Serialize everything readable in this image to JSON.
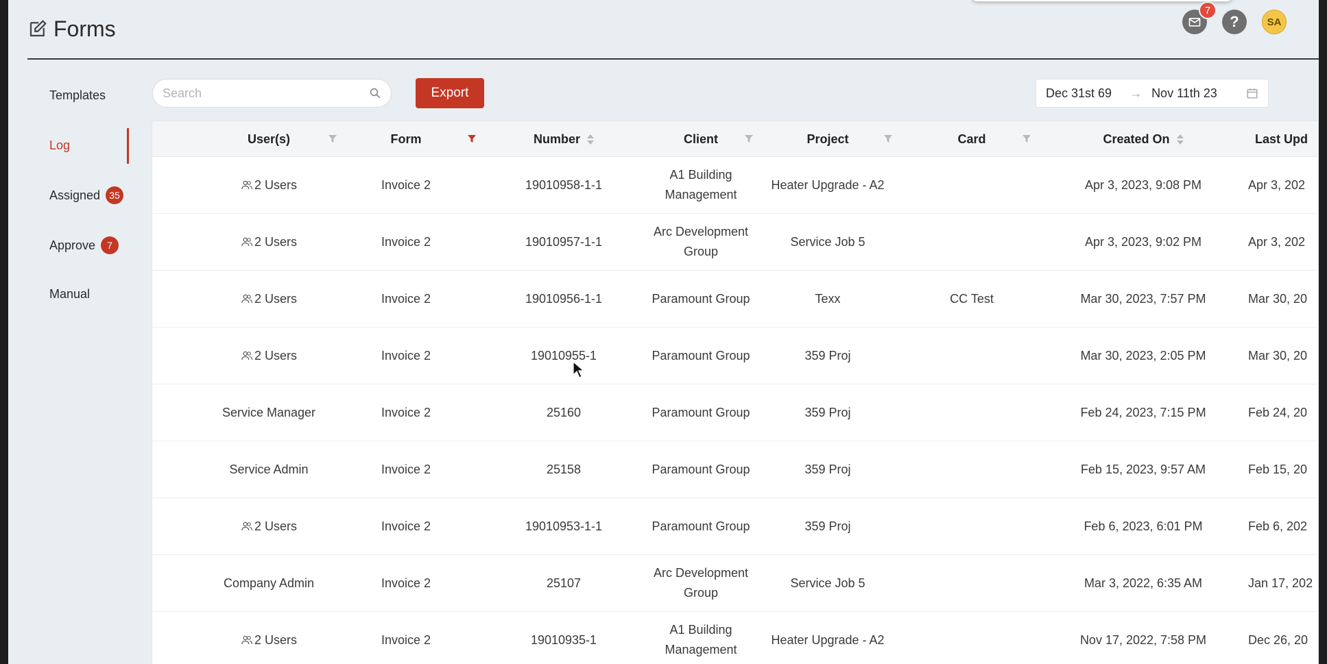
{
  "header": {
    "title": "Forms",
    "icon": "edit-icon"
  },
  "top_actions": {
    "mail_badge": "7",
    "help": "?",
    "avatar": "SA"
  },
  "sidebar": {
    "items": [
      {
        "label": "Templates",
        "badge": null
      },
      {
        "label": "Log",
        "badge": null,
        "active": true
      },
      {
        "label": "Assigned",
        "badge": "35"
      },
      {
        "label": "Approve",
        "badge": "7"
      },
      {
        "label": "Manual",
        "badge": null
      }
    ]
  },
  "toolbar": {
    "search_placeholder": "Search",
    "export_label": "Export",
    "date_from": "Dec 31st 69",
    "date_to": "Nov 11th 23",
    "arrow": "→"
  },
  "table": {
    "columns": [
      "User(s)",
      "Form",
      "Number",
      "Client",
      "Project",
      "Card",
      "Created On",
      "Last Upd"
    ],
    "rows": [
      {
        "users": "2 Users",
        "multi": true,
        "form": "Invoice 2",
        "number": "19010958-1-1",
        "client": "A1 Building Management",
        "project": "Heater Upgrade - A2",
        "card": "",
        "created": "Apr 3, 2023, 9:08 PM",
        "updated": "Apr 3, 202"
      },
      {
        "users": "2 Users",
        "multi": true,
        "form": "Invoice 2",
        "number": "19010957-1-1",
        "client": "Arc Development Group",
        "project": "Service Job 5",
        "card": "",
        "created": "Apr 3, 2023, 9:02 PM",
        "updated": "Apr 3, 202"
      },
      {
        "users": "2 Users",
        "multi": true,
        "form": "Invoice 2",
        "number": "19010956-1-1",
        "client": "Paramount Group",
        "project": "Texx",
        "card": "CC Test",
        "created": "Mar 30, 2023, 7:57 PM",
        "updated": "Mar 30, 20"
      },
      {
        "users": "2 Users",
        "multi": true,
        "form": "Invoice 2",
        "number": "19010955-1",
        "client": "Paramount Group",
        "project": "359 Proj",
        "card": "",
        "created": "Mar 30, 2023, 2:05 PM",
        "updated": "Mar 30, 20"
      },
      {
        "users": "Service Manager",
        "multi": false,
        "form": "Invoice 2",
        "number": "25160",
        "client": "Paramount Group",
        "project": "359 Proj",
        "card": "",
        "created": "Feb 24, 2023, 7:15 PM",
        "updated": "Feb 24, 20"
      },
      {
        "users": "Service Admin",
        "multi": false,
        "form": "Invoice 2",
        "number": "25158",
        "client": "Paramount Group",
        "project": "359 Proj",
        "card": "",
        "created": "Feb 15, 2023, 9:57 AM",
        "updated": "Feb 15, 20"
      },
      {
        "users": "2 Users",
        "multi": true,
        "form": "Invoice 2",
        "number": "19010953-1-1",
        "client": "Paramount Group",
        "project": "359 Proj",
        "card": "",
        "created": "Feb 6, 2023, 6:01 PM",
        "updated": "Feb 6, 202"
      },
      {
        "users": "Company Admin",
        "multi": false,
        "form": "Invoice 2",
        "number": "25107",
        "client": "Arc Development Group",
        "project": "Service Job 5",
        "card": "",
        "created": "Mar 3, 2022, 6:35 AM",
        "updated": "Jan 17, 202"
      },
      {
        "users": "2 Users",
        "multi": true,
        "form": "Invoice 2",
        "number": "19010935-1",
        "client": "A1 Building Management",
        "project": "Heater Upgrade - A2",
        "card": "",
        "created": "Nov 17, 2022, 7:58 PM",
        "updated": "Dec 26, 20"
      }
    ]
  },
  "colors": {
    "accent": "#c33724",
    "background": "#e9eef2"
  }
}
